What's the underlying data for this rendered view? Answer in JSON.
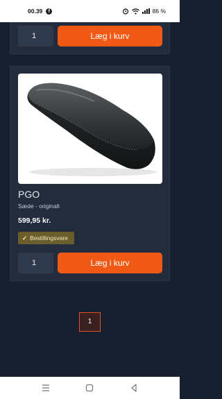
{
  "status_bar": {
    "time": "00.39",
    "app_icon": "facebook-icon",
    "battery": "86 %"
  },
  "top_card": {
    "quantity": "1",
    "add_to_cart_label": "Læg i kurv"
  },
  "product": {
    "image_icon": "scooter-seat-image",
    "brand": "PGO",
    "subtitle": "Sæde - originalt",
    "price": "599,95 kr.",
    "badge_label": "Bestillingsvare",
    "quantity": "1",
    "add_to_cart_label": "Læg i kurv"
  },
  "pagination": {
    "current_page": "1"
  },
  "colors": {
    "background": "#18202f",
    "card": "#222c3d",
    "accent": "#f05a16",
    "badge": "#6b5d2c"
  }
}
